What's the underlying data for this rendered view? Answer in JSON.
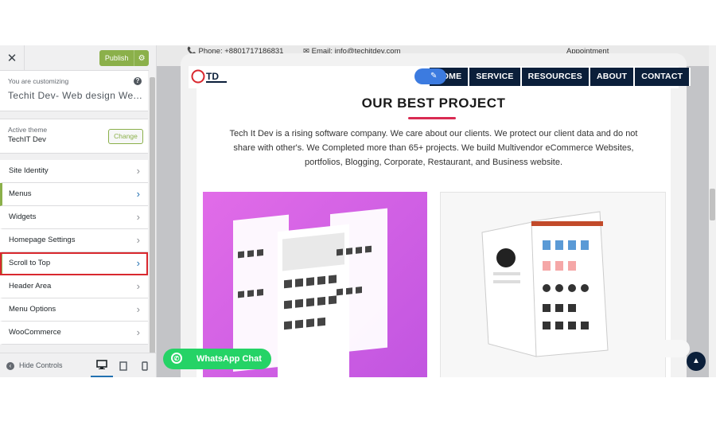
{
  "sidebar": {
    "publish_label": "Publish",
    "customizing_label": "You are customizing",
    "site_title": "Techit Dev- Web design We...",
    "active_theme_label": "Active theme",
    "theme_name": "TechIT Dev",
    "change_label": "Change",
    "items": [
      {
        "label": "Site Identity"
      },
      {
        "label": "Menus"
      },
      {
        "label": "Widgets"
      },
      {
        "label": "Homepage Settings"
      },
      {
        "label": "Scroll to Top"
      },
      {
        "label": "Header Area"
      },
      {
        "label": "Menu Options"
      },
      {
        "label": "WooCommerce"
      }
    ],
    "hide_controls_label": "Hide Controls"
  },
  "preview": {
    "topbar": {
      "phone": "Phone: +8801717186831",
      "email": "Email: info@techitdev.com",
      "appointment": "Appointment"
    },
    "nav": [
      "HOME",
      "SERVICE",
      "RESOURCES",
      "ABOUT",
      "CONTACT"
    ],
    "logo_text": "TD",
    "heading": "OUR BEST PROJECT",
    "paragraph": "Tech It Dev is a rising software company. We care about our clients. We protect our client data and do not share with other's. We Completed more than 65+ projects. We build Multivendor eCommerce Websites, portfolios, Blogging, Corporate, Restaurant, and Business website.",
    "whatsapp_label": "WhatsApp Chat"
  },
  "colors": {
    "accent_green": "#8bb04a",
    "nav_navy": "#0b1f3a",
    "whatsapp": "#25d366",
    "heading_underline": "#d92b52",
    "highlight_red": "#d9282f"
  }
}
